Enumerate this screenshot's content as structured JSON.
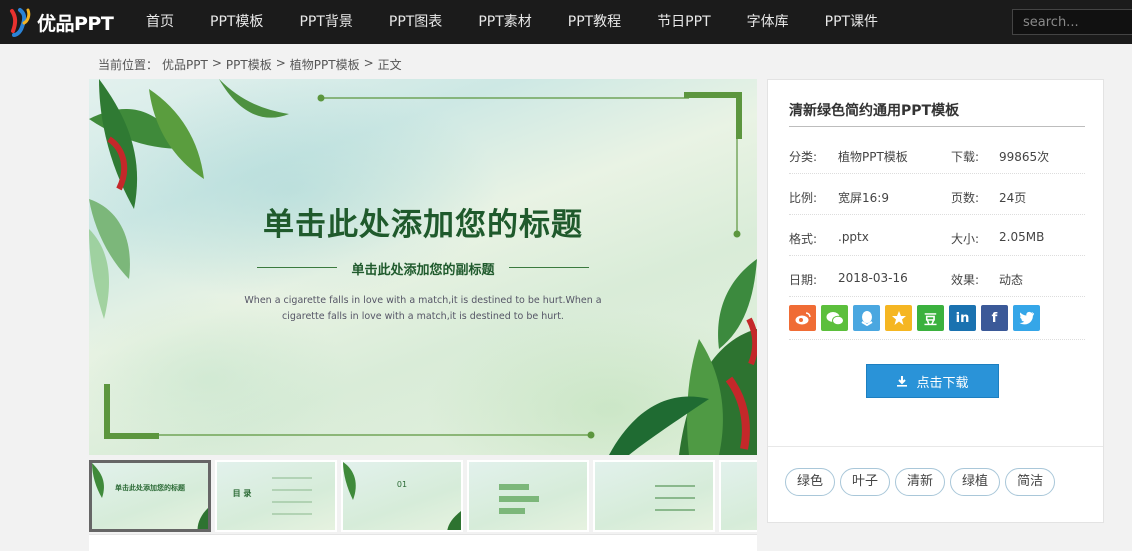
{
  "header": {
    "logo_text": "优品PPT",
    "nav": [
      "首页",
      "PPT模板",
      "PPT背景",
      "PPT图表",
      "PPT素材",
      "PPT教程",
      "节日PPT",
      "字体库",
      "PPT课件"
    ],
    "search_placeholder": "search..."
  },
  "breadcrumb": {
    "prefix": "当前位置：",
    "items": [
      "优品PPT",
      "PPT模板",
      "植物PPT模板",
      "正文"
    ],
    "separator": ">"
  },
  "preview": {
    "title": "单击此处添加您的标题",
    "subtitle": "单击此处添加您的副标题",
    "body_line1": "When a cigarette falls in love with a match,it is destined to be hurt.When a",
    "body_line2": "cigarette falls in love with a match,it is destined to be hurt."
  },
  "thumbnails": {
    "t1": "单击此处添加您的标题",
    "t2": "目 录",
    "t3": "01"
  },
  "sidebar": {
    "title": "清新绿色简约通用PPT模板",
    "rows": [
      {
        "k1": "分类:",
        "v1": "植物PPT模板",
        "k2": "下载:",
        "v2": "99865次"
      },
      {
        "k1": "比例:",
        "v1": "宽屏16:9",
        "k2": "页数:",
        "v2": "24页"
      },
      {
        "k1": "格式:",
        "v1": ".pptx",
        "k2": "大小:",
        "v2": "2.05MB"
      },
      {
        "k1": "日期:",
        "v1": "2018-03-16",
        "k2": "效果:",
        "v2": "动态"
      }
    ],
    "download_label": "点击下载",
    "tags": [
      "绿色",
      "叶子",
      "清新",
      "绿植",
      "简洁"
    ]
  },
  "share": {
    "weibo": "weibo-icon",
    "wechat": "wechat-icon",
    "qq": "qq-icon",
    "qzone": "qzone-icon",
    "douban_label": "豆",
    "linkedin_label": "in",
    "facebook_label": "f",
    "colors": {
      "weibo": "#f06c35",
      "wechat": "#5cbf3c",
      "qq": "#4aa7e0",
      "qzone": "#f5b622",
      "douban": "#3bb13e",
      "linkedin": "#1a72b0",
      "facebook": "#3b5998",
      "twitter": "#35a6e8"
    }
  },
  "colors": {
    "accent": "#2a93d8",
    "title_green": "#1f5a2c",
    "nav_bg": "#1b1b1b"
  }
}
